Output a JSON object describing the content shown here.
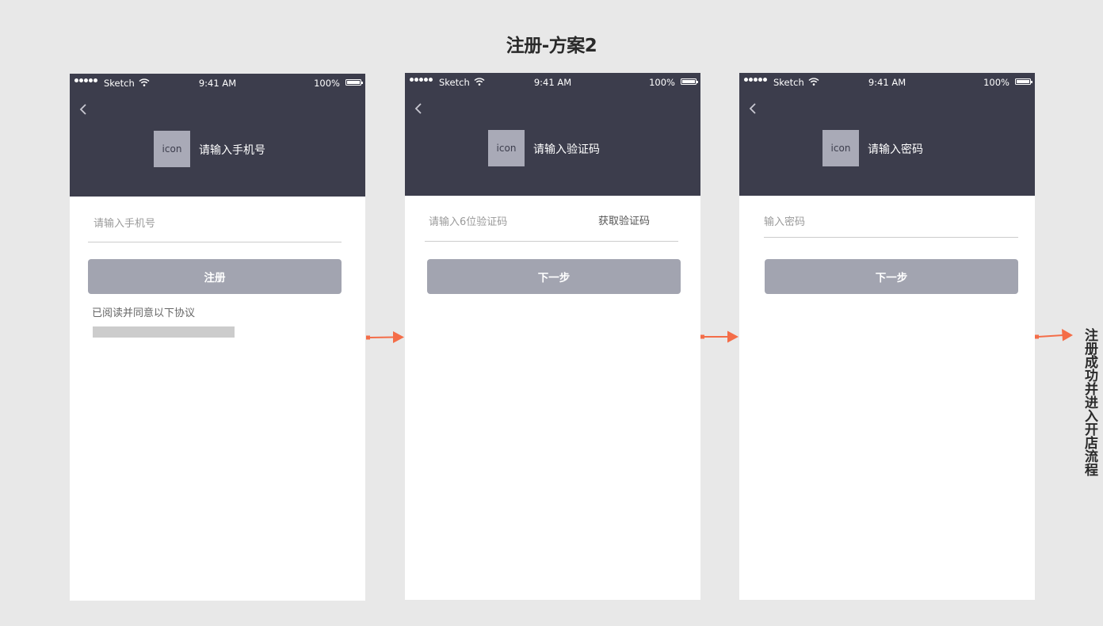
{
  "page": {
    "title": "注册-方案2"
  },
  "status_bar": {
    "carrier": "Sketch",
    "time": "9:41 AM",
    "battery": "100%"
  },
  "icons": {
    "back": "chevron-left-icon",
    "signal": "signal-dots-icon",
    "wifi": "wifi-icon",
    "battery": "battery-icon",
    "arrow": "arrow-right-icon"
  },
  "colors": {
    "background": "#e8e8e8",
    "header": "#3c3d4c",
    "icon_placeholder": "#a9aab7",
    "button": "#a2a4b0",
    "arrow": "#f46d48"
  },
  "screens": [
    {
      "icon_label": "icon",
      "header_title": "请输入手机号",
      "input_placeholder": "请输入手机号",
      "button_label": "注册",
      "agreement_text": "已阅读并同意以下协议"
    },
    {
      "icon_label": "icon",
      "header_title": "请输入验证码",
      "input_placeholder": "请输入6位验证码",
      "get_code_label": "获取验证码",
      "button_label": "下一步"
    },
    {
      "icon_label": "icon",
      "header_title": "请输入密码",
      "input_placeholder": "输入密码",
      "button_label": "下一步"
    }
  ],
  "final_note": "注册成功并进入开店流程"
}
